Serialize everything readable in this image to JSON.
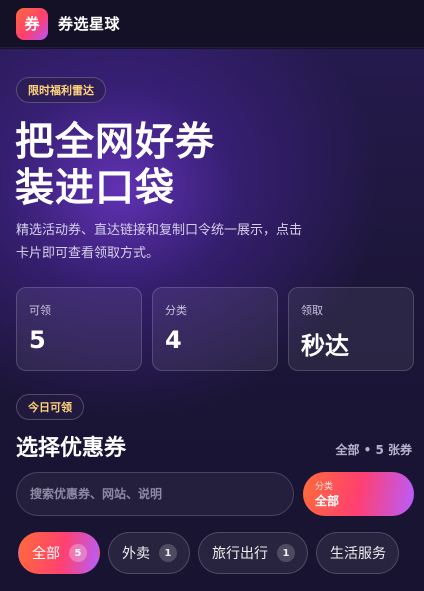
{
  "app": {
    "logo_text": "券",
    "name": "券选星球"
  },
  "hero": {
    "badge": "限时福利雷达",
    "title_line1": "把全网好券",
    "title_line2": "装进口袋",
    "desc_line1": "精选活动券、直达链接和复制口令统一展示，点击",
    "desc_line2": "卡片即可查看领取方式。"
  },
  "stats": [
    {
      "label": "可领",
      "value": "5"
    },
    {
      "label": "分类",
      "value": "4"
    },
    {
      "label": "领取",
      "value": "秒达"
    }
  ],
  "section": {
    "badge": "今日可领",
    "title": "选择优惠券",
    "count": "全部 • 5 张券"
  },
  "search": {
    "placeholder": "搜索优惠券、网站、说明",
    "value": ""
  },
  "category_button": {
    "small": "分类",
    "main": "全部"
  },
  "chips": [
    {
      "label": "全部",
      "count": "5",
      "active": true
    },
    {
      "label": "外卖",
      "count": "1",
      "active": false
    },
    {
      "label": "旅行出行",
      "count": "1",
      "active": false
    },
    {
      "label": "生活服务",
      "count": "",
      "active": false
    }
  ],
  "colors": {
    "accent_start": "#ff6a3a",
    "accent_mid": "#ff4170",
    "accent_end": "#b55eff",
    "badge_text": "#ffd37a",
    "background": "#17132b"
  }
}
